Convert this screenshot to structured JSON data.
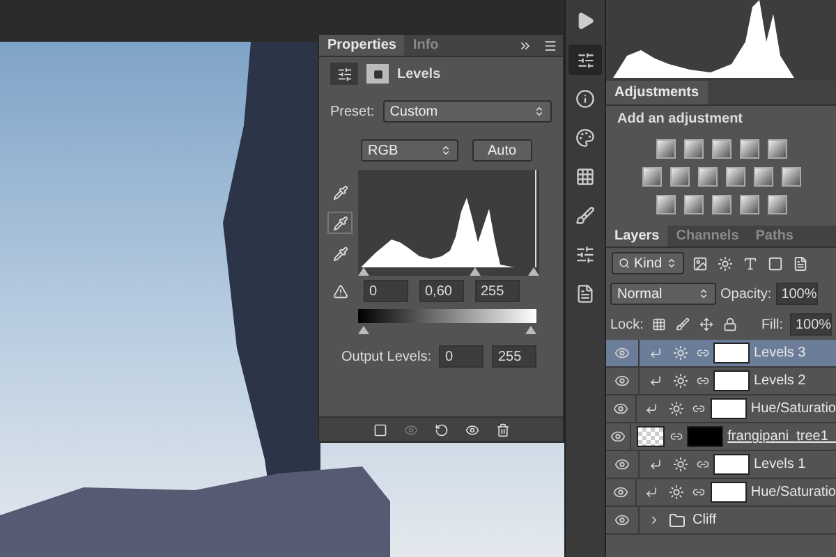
{
  "properties_panel": {
    "tabs": [
      {
        "label": "Properties",
        "selected": true
      },
      {
        "label": "Info",
        "selected": false
      }
    ],
    "title": "Levels",
    "preset": {
      "label": "Preset:",
      "value": "Custom"
    },
    "channel": "RGB",
    "auto_button": "Auto",
    "input_levels": [
      "0",
      "0,60",
      "255"
    ],
    "output_levels": {
      "label": "Output Levels:",
      "values": [
        "0",
        "255"
      ]
    }
  },
  "adjustments_panel": {
    "tab": "Adjustments",
    "heading": "Add an adjustment"
  },
  "layers_panel": {
    "tabs": [
      {
        "label": "Layers",
        "selected": true
      },
      {
        "label": "Channels",
        "selected": false
      },
      {
        "label": "Paths",
        "selected": false
      }
    ],
    "filter": "Kind",
    "blend_mode": "Normal",
    "opacity": {
      "label": "Opacity:",
      "value": "100%"
    },
    "lock_label": "Lock:",
    "fill": {
      "label": "Fill:",
      "value": "100%"
    },
    "layers": [
      {
        "name": "Levels 3",
        "kind": "adjustment",
        "selected": true,
        "visible": true
      },
      {
        "name": "Levels 2",
        "kind": "adjustment",
        "selected": false,
        "visible": true
      },
      {
        "name": "Hue/Saturatio",
        "kind": "adjustment",
        "selected": false,
        "visible": true
      },
      {
        "name": "frangipani_tree1_",
        "kind": "smart",
        "selected": false,
        "visible": true
      },
      {
        "name": "Levels 1",
        "kind": "adjustment",
        "selected": false,
        "visible": true
      },
      {
        "name": "Hue/Saturatio",
        "kind": "adjustment",
        "selected": false,
        "visible": true
      },
      {
        "name": "Cliff",
        "kind": "group",
        "selected": false,
        "visible": true
      }
    ]
  }
}
